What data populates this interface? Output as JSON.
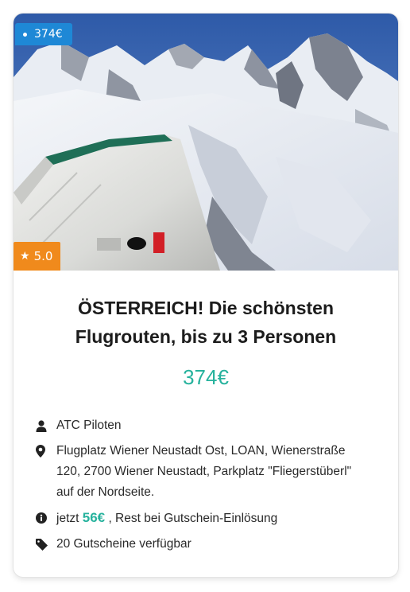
{
  "badge": {
    "price": "374€",
    "rating_icon": "star-icon",
    "rating": "5.0"
  },
  "hero": {
    "image_description_icon": "hero-image"
  },
  "offer": {
    "title_line1": "ÖSTERREICH! Die schönsten",
    "title_line2": "Flugrouten, bis zu 3 Personen",
    "price": "374€"
  },
  "details": {
    "pilot_icon": "person-icon",
    "pilot": "ATC Piloten",
    "location_icon": "map-pin-icon",
    "location_line1": "Flugplatz Wiener Neustadt Ost, LOAN, Wienerstraße",
    "location_line2": "120, 2700 Wiener Neustadt, Parkplatz \"Fliegerstüberl\"",
    "location_line3": "auf der Nordseite.",
    "payment_icon": "info-icon",
    "payment_prefix": "jetzt",
    "payment_amount": "56€",
    "payment_suffix": ", Rest bei Gutschein-Einlösung",
    "vouchers_icon": "tag-icon",
    "vouchers": "20 Gutscheine verfügbar"
  },
  "colors": {
    "accent_green": "#26b29d",
    "ribbon_blue": "#1e88d6",
    "rating_orange": "#f08a1c"
  }
}
